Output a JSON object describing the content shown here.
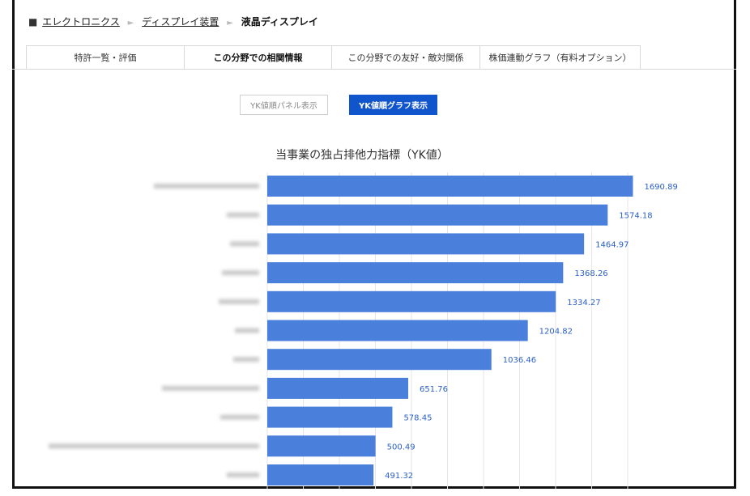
{
  "breadcrumb": {
    "square": "■",
    "items": [
      "エレクトロニクス",
      "ディスプレイ装置"
    ],
    "separator": "►",
    "current": "液晶ディスプレイ"
  },
  "tabs": [
    {
      "label": "特許一覧・評価",
      "active": false
    },
    {
      "label": "この分野での相関情報",
      "active": true
    },
    {
      "label": "この分野での友好・敵対関係",
      "active": false
    },
    {
      "label": "株価連動グラフ（有料オプション）",
      "active": false
    }
  ],
  "view_buttons": {
    "panel_label": "YK値順パネル表示",
    "graph_label": "YK値順グラフ表示"
  },
  "colors": {
    "bar": "#4a7fdb",
    "value_label": "#2b5fc8",
    "active_button": "#1155cc"
  },
  "chart_data": {
    "type": "bar",
    "orientation": "horizontal",
    "title": "当事業の独占排他力指標（YK値）",
    "categories": [
      "",
      "",
      "",
      "",
      "",
      "",
      "",
      "",
      "",
      "",
      ""
    ],
    "values": [
      1690.89,
      1574.18,
      1464.97,
      1368.26,
      1334.27,
      1204.82,
      1036.46,
      651.76,
      578.45,
      500.49,
      491.32
    ],
    "value_labels": [
      "1690.89",
      "1574.18",
      "1464.97",
      "1368.26",
      "1334.27",
      "1204.82",
      "1036.46",
      "651.76",
      "578.45",
      "500.49",
      "491.32"
    ],
    "xlim": [
      0,
      2000
    ],
    "grid": true,
    "category_labels_blurred": true
  }
}
